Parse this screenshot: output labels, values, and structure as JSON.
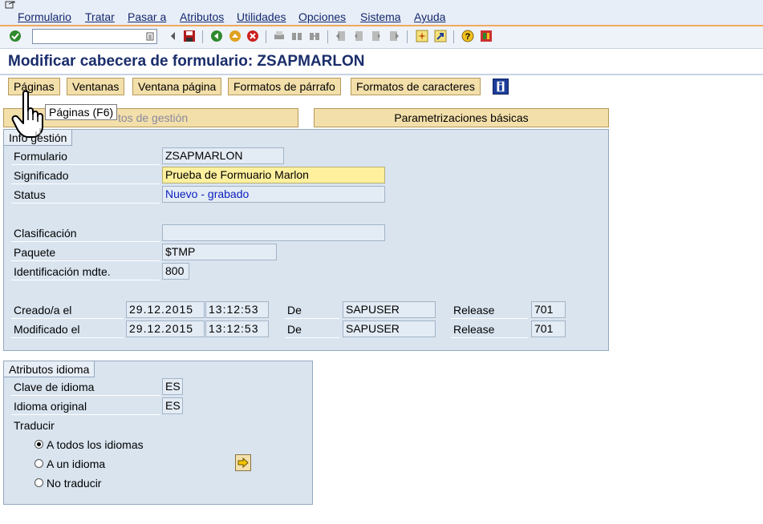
{
  "menu": [
    "Formulario",
    "Tratar",
    "Pasar a",
    "Atributos",
    "Utilidades",
    "Opciones",
    "Sistema",
    "Ayuda"
  ],
  "toolbar": {
    "command_field": "",
    "icons": [
      "enter-icon",
      "back-nav-icon",
      "save-icon",
      "back-icon",
      "exit-icon",
      "cancel-icon",
      "print-icon",
      "find-icon",
      "find-next-icon",
      "first-page-icon",
      "prev-page-icon",
      "next-page-icon",
      "last-page-icon",
      "new-session-icon",
      "shortcut-icon",
      "help-icon",
      "customize-layout-icon"
    ]
  },
  "title": "Modificar cabecera de formulario: ZSAPMARLON",
  "app_buttons": [
    "Páginas",
    "Ventanas",
    "Ventana página",
    "Formatos de párrafo",
    "Formatos de caracteres"
  ],
  "tooltip": "Páginas   (F6)",
  "tabs": {
    "datos_gestion": "Datos de gestión",
    "parametrizaciones": "Parametrizaciones básicas",
    "datos_gestion_visible": "tos de gestión"
  },
  "info_gestion": {
    "header": "Info gestión",
    "formulario_label": "Formulario",
    "formulario": "ZSAPMARLON",
    "significado_label": "Significado",
    "significado": "Prueba de Formuario Marlon",
    "status_label": "Status",
    "status": "Nuevo - grabado",
    "clasificacion_label": "Clasificación",
    "clasificacion": "",
    "paquete_label": "Paquete",
    "paquete": "$TMP",
    "ident_label": "Identificación mdte.",
    "ident": "800",
    "creado_label": "Creado/a el",
    "creado_fecha": "29.12.2015",
    "creado_hora": "13:12:53",
    "de_label": "De",
    "creado_user": "SAPUSER",
    "release_label": "Release",
    "creado_release": "701",
    "modificado_label": "Modificado el",
    "modificado_fecha": "29.12.2015",
    "modificado_hora": "13:12:53",
    "modificado_user": "SAPUSER",
    "modificado_release": "701"
  },
  "atributos_idioma": {
    "header": "Atributos idioma",
    "clave_label": "Clave de idioma",
    "clave": "ES",
    "original_label": "Idioma original",
    "original": "ES",
    "traducir_label": "Traducir",
    "options": [
      "A todos los idiomas",
      "A un idioma",
      "No traducir"
    ],
    "selected": 0
  },
  "colors": {
    "accent": "#f0a860",
    "title": "#1a2d6b",
    "panel": "#d9e4ef",
    "button": "#f3dfaa"
  }
}
